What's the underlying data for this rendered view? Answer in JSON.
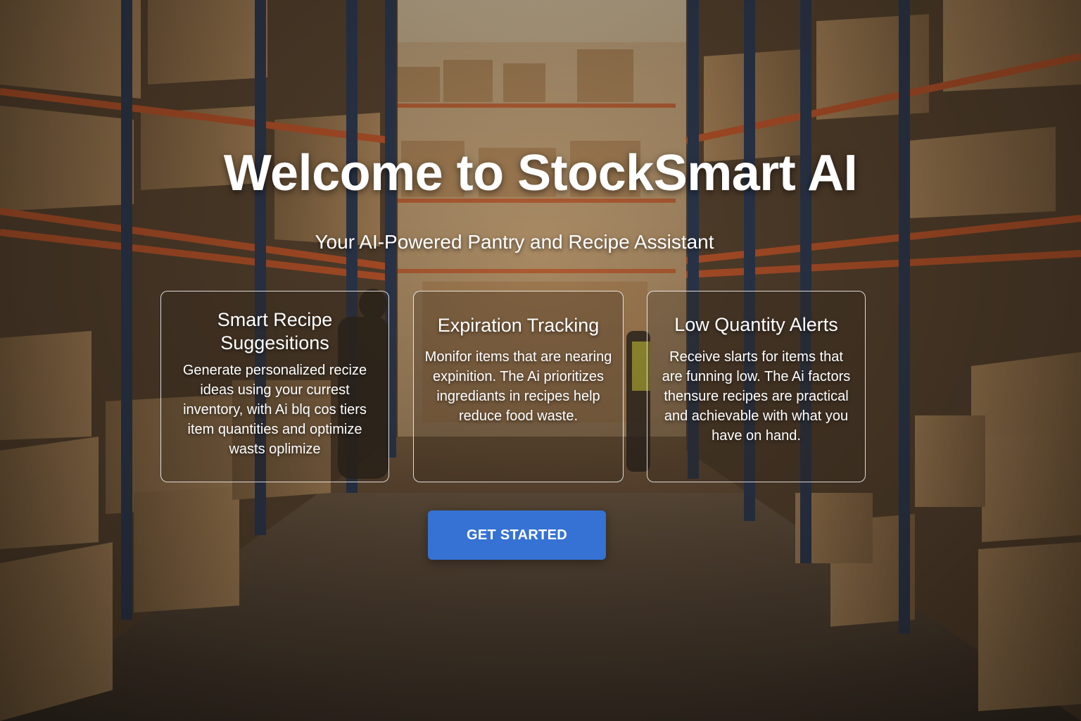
{
  "hero": {
    "title": "Welcome to StockSmart AI",
    "subtitle": "Your AI-Powered Pantry and Recipe Assistant"
  },
  "features": [
    {
      "title": "Smart Recipe Suggesitions",
      "description": "Generate personalized recize ideas using your currest inventory, with Ai blq cos tiers item quantities and optimize wasts oplimize"
    },
    {
      "title": "Expiration Tracking",
      "description": "Monifor items that are nearing expinition. The Ai prioritizes ingrediants in recipes help reduce food waste."
    },
    {
      "title": "Low Quantity Alerts",
      "description": "Receive slarts for items that are funning low. The Ai factors thensure recipes are practical and achievable with what you have on hand."
    }
  ],
  "cta": {
    "label": "GET STARTED"
  },
  "colors": {
    "button": "#3572d3",
    "card_border": "#ffffff",
    "rack_orange": "#c8582a",
    "rack_blue": "#2b3b57"
  },
  "background": {
    "description_icon": "warehouse-aisle-image"
  }
}
